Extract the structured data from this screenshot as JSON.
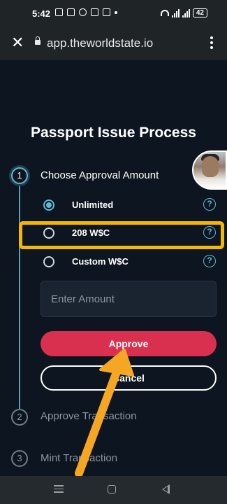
{
  "status_bar": {
    "time": "5:42",
    "battery": "42"
  },
  "browser": {
    "url": "app.theworldstate.io"
  },
  "page": {
    "title": "Passport Issue Process"
  },
  "steps": [
    {
      "number": "1",
      "label": "Choose Approval Amount"
    },
    {
      "number": "2",
      "label": "Approve Transaction"
    },
    {
      "number": "3",
      "label": "Mint Transaction"
    }
  ],
  "options": [
    {
      "label": "Unlimited",
      "selected": true
    },
    {
      "label": "208 W$C",
      "selected": false
    },
    {
      "label": "Custom W$C",
      "selected": false
    }
  ],
  "help_glyph": "?",
  "amount_input": {
    "placeholder": "Enter Amount",
    "value": ""
  },
  "buttons": {
    "approve": "Approve",
    "cancel": "Cancel"
  },
  "colors": {
    "accent": "#5fb8d4",
    "approve": "#d9304f",
    "highlight": "#f5b800",
    "arrow": "#f5a623",
    "background": "#0d1620"
  }
}
